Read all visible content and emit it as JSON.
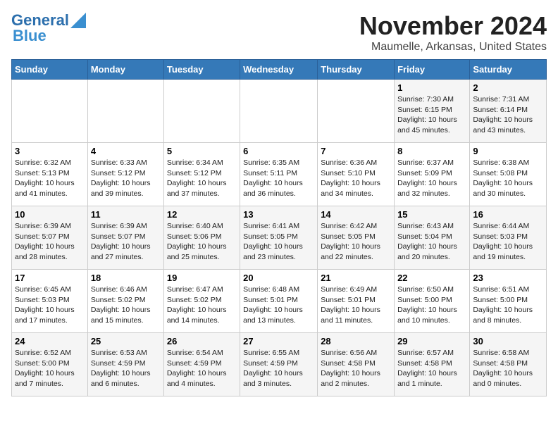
{
  "logo": {
    "part1": "General",
    "part2": "Blue"
  },
  "title": "November 2024",
  "location": "Maumelle, Arkansas, United States",
  "days_of_week": [
    "Sunday",
    "Monday",
    "Tuesday",
    "Wednesday",
    "Thursday",
    "Friday",
    "Saturday"
  ],
  "weeks": [
    [
      {
        "day": "",
        "info": ""
      },
      {
        "day": "",
        "info": ""
      },
      {
        "day": "",
        "info": ""
      },
      {
        "day": "",
        "info": ""
      },
      {
        "day": "",
        "info": ""
      },
      {
        "day": "1",
        "info": "Sunrise: 7:30 AM\nSunset: 6:15 PM\nDaylight: 10 hours and 45 minutes."
      },
      {
        "day": "2",
        "info": "Sunrise: 7:31 AM\nSunset: 6:14 PM\nDaylight: 10 hours and 43 minutes."
      }
    ],
    [
      {
        "day": "3",
        "info": "Sunrise: 6:32 AM\nSunset: 5:13 PM\nDaylight: 10 hours and 41 minutes."
      },
      {
        "day": "4",
        "info": "Sunrise: 6:33 AM\nSunset: 5:12 PM\nDaylight: 10 hours and 39 minutes."
      },
      {
        "day": "5",
        "info": "Sunrise: 6:34 AM\nSunset: 5:12 PM\nDaylight: 10 hours and 37 minutes."
      },
      {
        "day": "6",
        "info": "Sunrise: 6:35 AM\nSunset: 5:11 PM\nDaylight: 10 hours and 36 minutes."
      },
      {
        "day": "7",
        "info": "Sunrise: 6:36 AM\nSunset: 5:10 PM\nDaylight: 10 hours and 34 minutes."
      },
      {
        "day": "8",
        "info": "Sunrise: 6:37 AM\nSunset: 5:09 PM\nDaylight: 10 hours and 32 minutes."
      },
      {
        "day": "9",
        "info": "Sunrise: 6:38 AM\nSunset: 5:08 PM\nDaylight: 10 hours and 30 minutes."
      }
    ],
    [
      {
        "day": "10",
        "info": "Sunrise: 6:39 AM\nSunset: 5:07 PM\nDaylight: 10 hours and 28 minutes."
      },
      {
        "day": "11",
        "info": "Sunrise: 6:39 AM\nSunset: 5:07 PM\nDaylight: 10 hours and 27 minutes."
      },
      {
        "day": "12",
        "info": "Sunrise: 6:40 AM\nSunset: 5:06 PM\nDaylight: 10 hours and 25 minutes."
      },
      {
        "day": "13",
        "info": "Sunrise: 6:41 AM\nSunset: 5:05 PM\nDaylight: 10 hours and 23 minutes."
      },
      {
        "day": "14",
        "info": "Sunrise: 6:42 AM\nSunset: 5:05 PM\nDaylight: 10 hours and 22 minutes."
      },
      {
        "day": "15",
        "info": "Sunrise: 6:43 AM\nSunset: 5:04 PM\nDaylight: 10 hours and 20 minutes."
      },
      {
        "day": "16",
        "info": "Sunrise: 6:44 AM\nSunset: 5:03 PM\nDaylight: 10 hours and 19 minutes."
      }
    ],
    [
      {
        "day": "17",
        "info": "Sunrise: 6:45 AM\nSunset: 5:03 PM\nDaylight: 10 hours and 17 minutes."
      },
      {
        "day": "18",
        "info": "Sunrise: 6:46 AM\nSunset: 5:02 PM\nDaylight: 10 hours and 15 minutes."
      },
      {
        "day": "19",
        "info": "Sunrise: 6:47 AM\nSunset: 5:02 PM\nDaylight: 10 hours and 14 minutes."
      },
      {
        "day": "20",
        "info": "Sunrise: 6:48 AM\nSunset: 5:01 PM\nDaylight: 10 hours and 13 minutes."
      },
      {
        "day": "21",
        "info": "Sunrise: 6:49 AM\nSunset: 5:01 PM\nDaylight: 10 hours and 11 minutes."
      },
      {
        "day": "22",
        "info": "Sunrise: 6:50 AM\nSunset: 5:00 PM\nDaylight: 10 hours and 10 minutes."
      },
      {
        "day": "23",
        "info": "Sunrise: 6:51 AM\nSunset: 5:00 PM\nDaylight: 10 hours and 8 minutes."
      }
    ],
    [
      {
        "day": "24",
        "info": "Sunrise: 6:52 AM\nSunset: 5:00 PM\nDaylight: 10 hours and 7 minutes."
      },
      {
        "day": "25",
        "info": "Sunrise: 6:53 AM\nSunset: 4:59 PM\nDaylight: 10 hours and 6 minutes."
      },
      {
        "day": "26",
        "info": "Sunrise: 6:54 AM\nSunset: 4:59 PM\nDaylight: 10 hours and 4 minutes."
      },
      {
        "day": "27",
        "info": "Sunrise: 6:55 AM\nSunset: 4:59 PM\nDaylight: 10 hours and 3 minutes."
      },
      {
        "day": "28",
        "info": "Sunrise: 6:56 AM\nSunset: 4:58 PM\nDaylight: 10 hours and 2 minutes."
      },
      {
        "day": "29",
        "info": "Sunrise: 6:57 AM\nSunset: 4:58 PM\nDaylight: 10 hours and 1 minute."
      },
      {
        "day": "30",
        "info": "Sunrise: 6:58 AM\nSunset: 4:58 PM\nDaylight: 10 hours and 0 minutes."
      }
    ]
  ]
}
